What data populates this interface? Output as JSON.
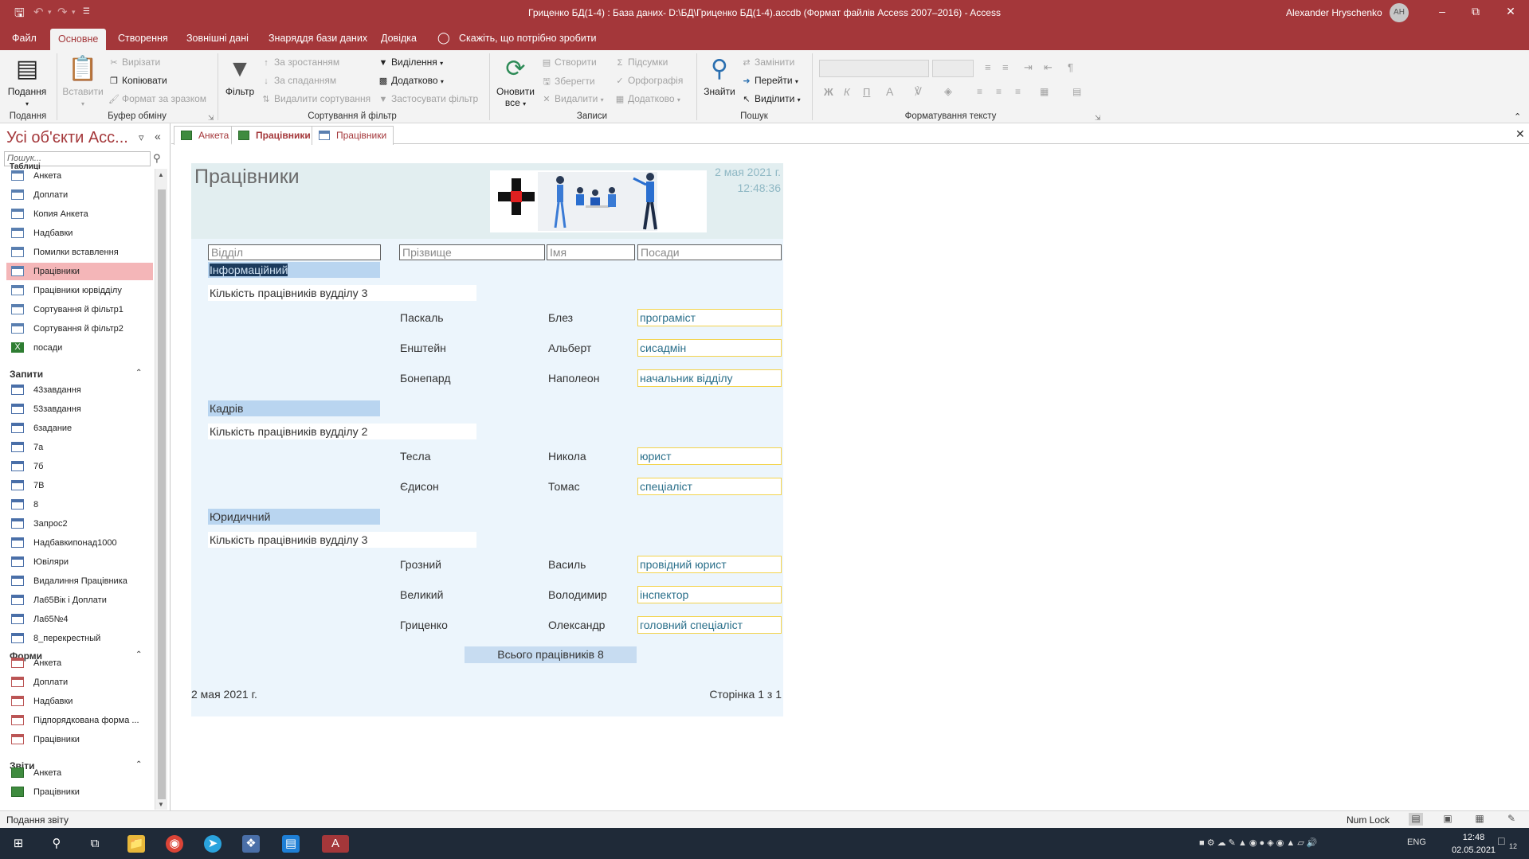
{
  "titlebar": {
    "title": "Гриценко БД(1-4) : База даних- D:\\БД\\Гриценко БД(1-4).accdb (Формат файлів Access 2007–2016)  -  Access",
    "user": "Alexander Hryschenko",
    "initials": "AH"
  },
  "ribbon_tabs": [
    "Файл",
    "Основне",
    "Створення",
    "Зовнішні дані",
    "Знаряддя бази даних",
    "Довідка",
    "Скажіть, що потрібно зробити"
  ],
  "ribbon": {
    "views": {
      "label": "Подання",
      "group": "Подання"
    },
    "clipboard": {
      "paste": "Вставити",
      "cut": "Вирізати",
      "copy": "Копіювати",
      "format_painter": "Формат за зразком",
      "group": "Буфер обміну"
    },
    "sort_filter": {
      "filter": "Фільтр",
      "ascending": "За зростанням",
      "descending": "За спаданням",
      "remove_sort": "Видалити сортування",
      "selection": "Виділення",
      "advanced": "Додатково",
      "toggle_filter": "Застосувати фільтр",
      "group": "Сортування й фільтр"
    },
    "records": {
      "refresh_line1": "Оновити",
      "refresh_line2": "все",
      "new": "Створити",
      "save": "Зберегти",
      "delete": "Видалити",
      "totals": "Підсумки",
      "spelling": "Орфографія",
      "more": "Додатково",
      "group": "Записи"
    },
    "find": {
      "find": "Знайти",
      "replace": "Замінити",
      "goto": "Перейти",
      "select": "Виділити",
      "group": "Пошук"
    },
    "text_format": {
      "bold": "Ж",
      "italic": "К",
      "underline": "П",
      "group": "Форматування тексту"
    }
  },
  "nav": {
    "title": "Усі об'єкти Acc...",
    "search_placeholder": "Пошук...",
    "tables_header": "Таблиці",
    "tables": [
      "Анкета",
      "Доплати",
      "Копия Анкета",
      "Надбавки",
      "Помилки вставлення",
      "Працівники",
      "Працівники юрвідділу",
      "Сортування й фільтр1",
      "Сортування й фільтр2",
      "посади"
    ],
    "queries_header": "Запити",
    "queries": [
      "43завдання",
      "53завдання",
      "6задание",
      "7а",
      "7б",
      "7В",
      "8",
      "Запрос2",
      "Надбавкипонад1000",
      "Ювіляри",
      "Видалиння Працівника",
      "Ла65Вік і Доплати",
      "Ла65№4",
      "8_перекрестный"
    ],
    "forms_header": "Форми",
    "forms": [
      "Анкета",
      "Доплати",
      "Надбавки",
      "Підпорядкована форма ...",
      "Працівники"
    ],
    "reports_header": "Звіти",
    "reports": [
      "Анкета",
      "Працівники"
    ]
  },
  "doc_tabs": [
    "Анкета",
    "Працівники",
    "Працівники"
  ],
  "report": {
    "title": "Працівники",
    "date": "2 мая 2021 г.",
    "time": "12:48:36",
    "headers": {
      "dept": "Відділ",
      "surname": "Прізвище",
      "name": "Імя",
      "position": "Посади"
    },
    "groups": [
      {
        "dept": "Інформаційний",
        "count": "Кількість працівників вудділу 3",
        "rows": [
          [
            "Паскаль",
            "Блез",
            "програміст"
          ],
          [
            "Енштейн",
            "Альберт",
            "сисадмін"
          ],
          [
            "Бонепард",
            "Наполеон",
            "начальник відділу"
          ]
        ]
      },
      {
        "dept": "Кадрів",
        "count": "Кількість працівників вудділу 2",
        "rows": [
          [
            "Тесла",
            "Никола",
            "юрист"
          ],
          [
            "Єдисон",
            "Томас",
            "спеціаліст"
          ]
        ]
      },
      {
        "dept": "Юридичний",
        "count": "Кількість працівників вудділу 3",
        "rows": [
          [
            "Грозний",
            "Василь",
            "провідний юрист"
          ],
          [
            "Великий",
            "Володимир",
            "інспектор"
          ],
          [
            "Гриценко",
            "Олександр",
            "головний спеціаліст"
          ]
        ]
      }
    ],
    "total": "Всього працівників 8",
    "footer_date": "2 мая 2021 г.",
    "footer_page": "Сторінка 1 з 1"
  },
  "status": {
    "left": "Подання звіту",
    "numlock": "Num Lock"
  },
  "taskbar": {
    "lang": "ENG",
    "time": "12:48",
    "date": "02.05.2021",
    "notifications": "12"
  },
  "colors": {
    "accent": "#a4373a",
    "report_bg": "#ecf5fc",
    "group_band": "#b9d5f0",
    "position_border": "#f3d34c"
  }
}
